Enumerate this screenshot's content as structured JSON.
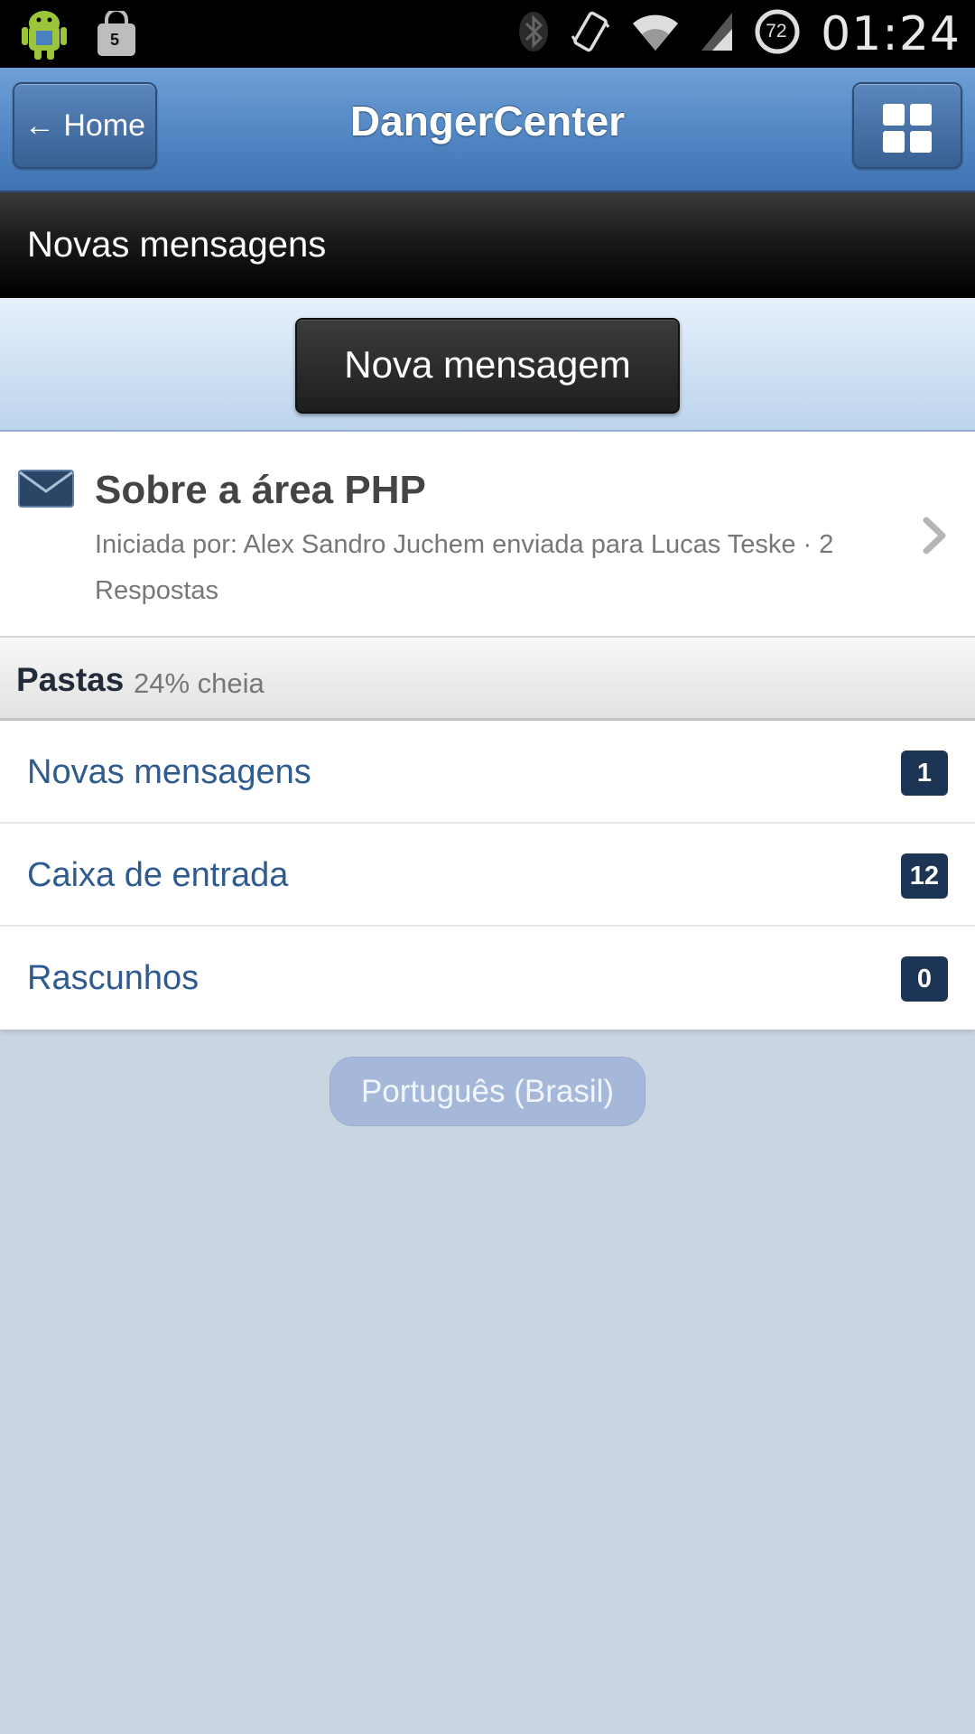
{
  "status_bar": {
    "notification_count": "5",
    "battery_level": "72",
    "time": "01:24"
  },
  "header": {
    "back_label": "← Home",
    "title": "DangerCenter"
  },
  "section": {
    "title": "Novas mensagens"
  },
  "new_message": {
    "label": "Nova mensagem"
  },
  "conversation": {
    "title": "Sobre a área PHP",
    "subtitle": "Iniciada por: Alex Sandro Juchem enviada para Lucas Teske · 2 Respostas"
  },
  "folders": {
    "title": "Pastas",
    "usage": "24% cheia",
    "items": [
      {
        "label": "Novas mensagens",
        "count": "1"
      },
      {
        "label": "Caixa de entrada",
        "count": "12"
      },
      {
        "label": "Rascunhos",
        "count": "0"
      }
    ]
  },
  "footer": {
    "language": "Português (Brasil)"
  },
  "colors": {
    "header_blue": "#4f84c2",
    "badge": "#1d3554",
    "link": "#2f5b8f"
  }
}
